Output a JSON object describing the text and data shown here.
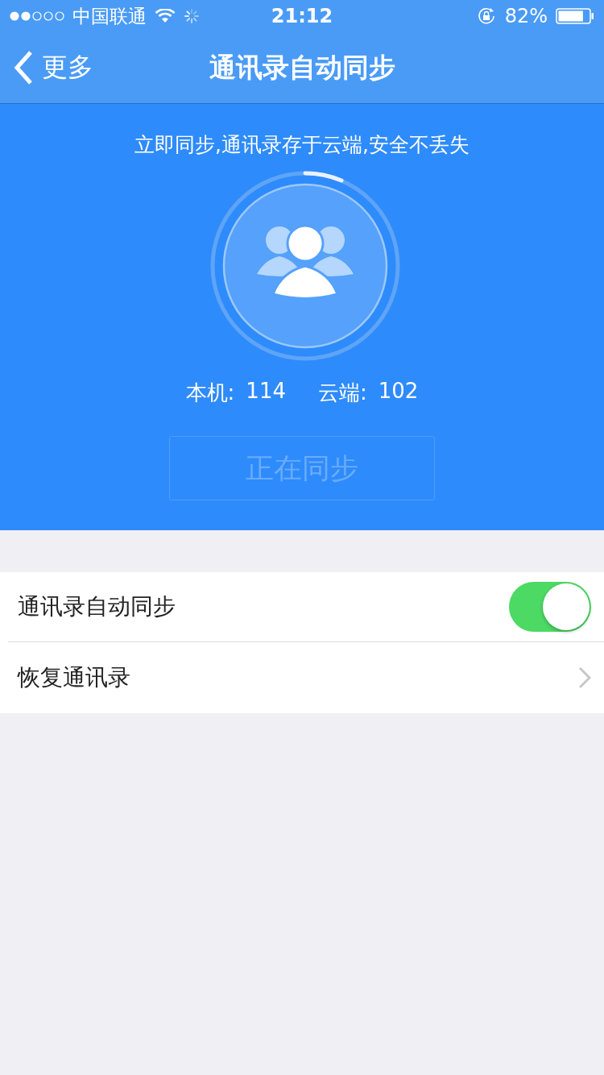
{
  "status_bar": {
    "carrier": "中国联通",
    "signal_dots": [
      {
        "filled": true
      },
      {
        "filled": true
      },
      {
        "filled": false
      },
      {
        "filled": false
      },
      {
        "filled": false
      }
    ],
    "time": "21:12",
    "battery": "82%"
  },
  "nav_bar": {
    "back_label": "更多",
    "title": "通讯录自动同步"
  },
  "sync_panel": {
    "slogan": "立即同步,通讯录存于云端,安全不丢失",
    "counts": [
      {
        "label": "本机:",
        "value": "114"
      },
      {
        "label": "云端:",
        "value": "102"
      }
    ],
    "sync_button": {
      "label": "正在同步",
      "disabled": true
    }
  },
  "settings": [
    {
      "kind": "toggle",
      "label": "通讯录自动同步",
      "on": true
    },
    {
      "kind": "link",
      "label": "恢复通讯录"
    }
  ]
}
